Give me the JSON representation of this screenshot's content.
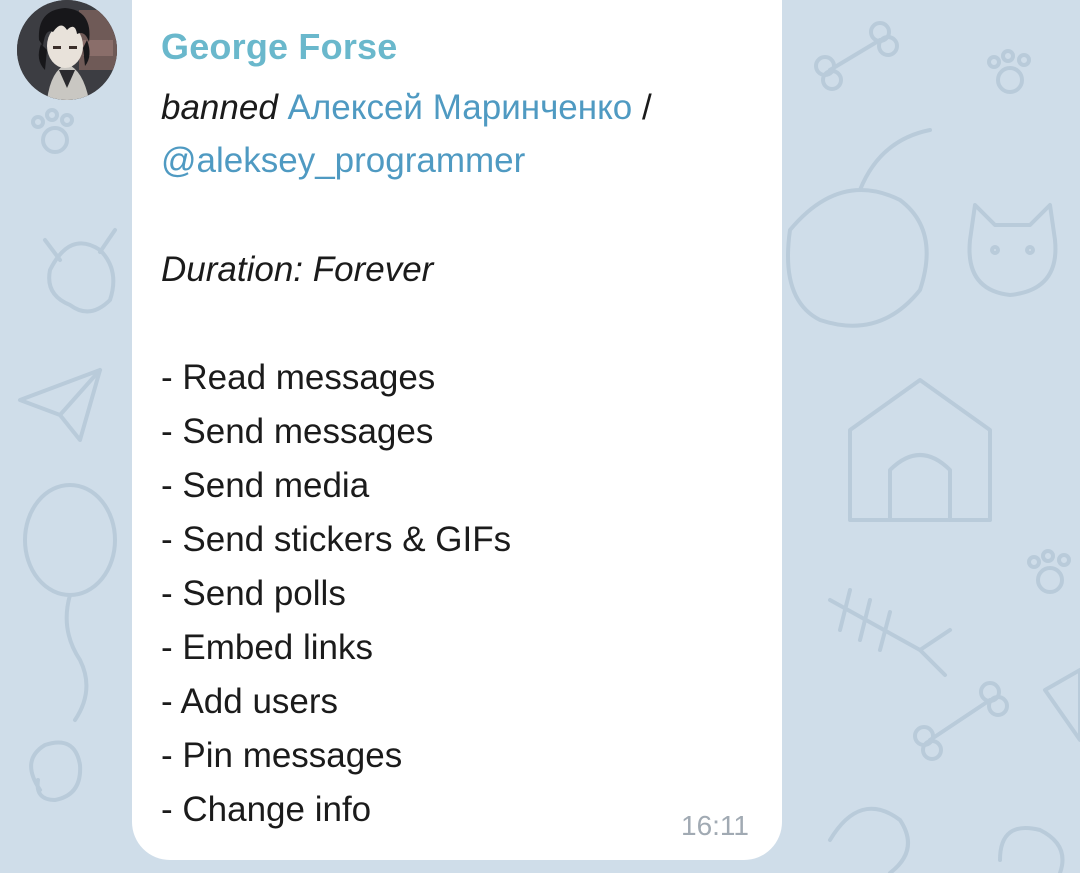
{
  "message": {
    "sender_name": "George Forse",
    "action_word": "banned",
    "target_name": "Алексей Маринченко",
    "separator": "/",
    "target_username": "@aleksey_programmer",
    "duration_line": "Duration: Forever",
    "restrictions": [
      "- Read messages",
      "- Send messages",
      "- Send media",
      "- Send stickers & GIFs",
      "- Send polls",
      "- Embed links",
      "- Add users",
      "- Pin messages",
      "- Change info"
    ],
    "time": "16:11"
  },
  "colors": {
    "wallpaper": "#cfdde9",
    "bubble": "#ffffff",
    "sender_name": "#6ab8cc",
    "link": "#4f9ac2",
    "text": "#1b1b1b",
    "time": "#a1aab3"
  },
  "avatar": {
    "icon": "anime-character-avatar"
  }
}
